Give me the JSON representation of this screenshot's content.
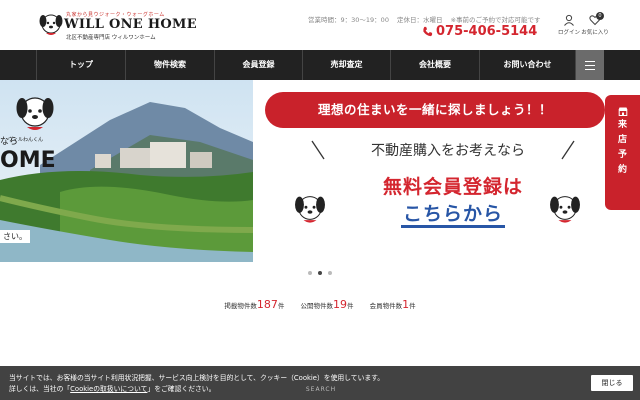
{
  "header": {
    "logo_tagline": "丸家から見ウジォーク・ウォーグホーム",
    "logo_main": "WILL ONE HOME",
    "logo_sub": "北区不動産専門店 ウィルワンホーム",
    "hours": "営業時間：9：30～19：00",
    "holiday": "定休日：水曜日",
    "reservation_note": "※事前のご予約で対応可能です",
    "phone": "075-406-5144",
    "login_label": "ログイン",
    "favorites_label": "お気に入り",
    "favorites_count": "0"
  },
  "nav": {
    "items": [
      "トップ",
      "物件検索",
      "会員登録",
      "売却査定",
      "会社概要",
      "お問い合わせ"
    ],
    "menu_icon": "hamburger-icon"
  },
  "hero": {
    "left_text_top": "なら",
    "left_text_big": "OME",
    "left_text_bottom": "さい。",
    "mascot_label": "ウィルわんくん",
    "banner": "理想の住まいを一緒に探しましょう！！",
    "consider": "不動産購入をお考えなら",
    "free_signup": "無料会員登録は",
    "here": "こちらから",
    "side_tab": [
      "来",
      "店",
      "予",
      "約"
    ]
  },
  "slider": {
    "count": 3,
    "active": 1
  },
  "stats": {
    "listed_label": "掲載物件数",
    "listed_value": "187",
    "listed_unit": "件",
    "public_label": "公開物件数",
    "public_value": "19",
    "public_unit": "件",
    "members_label": "会員物件数",
    "members_value": "1",
    "members_unit": "件"
  },
  "search_label": "SEARCH",
  "cookie": {
    "line1": "当サイトでは、お客様の当サイト利用状況把握、サービス向上検討を目的として、クッキー（Cookie）を使用しています。",
    "line2_pre": "詳しくは、当社の「",
    "line2_link": "Cookieの取扱いについて",
    "line2_post": "」をご確認ください。",
    "close_label": "閉じる"
  },
  "colors": {
    "accent_red": "#d4262f",
    "nav_bg": "#222222",
    "link_blue": "#2856a6"
  }
}
